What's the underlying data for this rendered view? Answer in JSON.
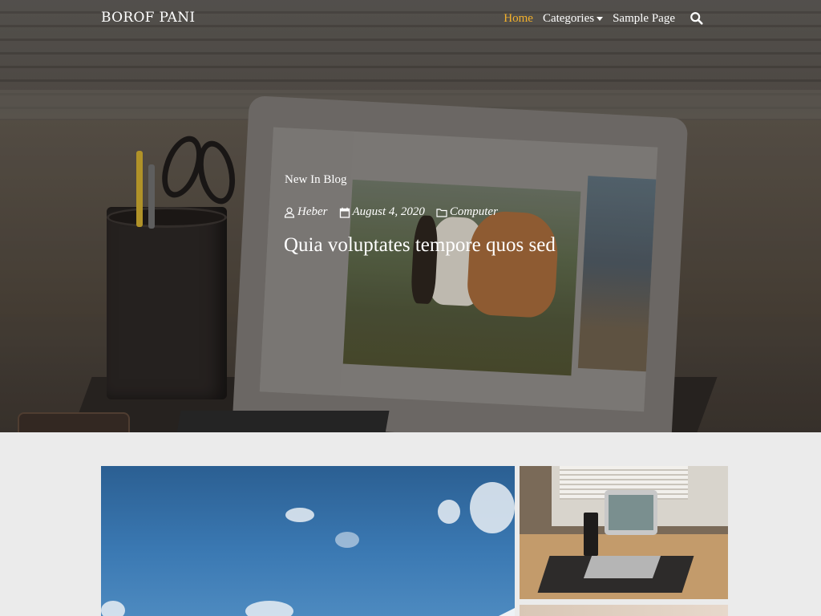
{
  "navbar": {
    "brand": "BOROF PANI",
    "links": [
      {
        "label": "Home",
        "active": true
      },
      {
        "label": "Categories",
        "dropdown": true
      },
      {
        "label": "Sample Page"
      }
    ],
    "search_icon": "search-icon"
  },
  "hero": {
    "category": "New In Blog",
    "meta": {
      "author": "Heber",
      "date": "August 4, 2020",
      "category": "Computer"
    },
    "title": "Quia voluptates tempore quos sed",
    "icons": [
      "user-icon",
      "calendar-icon",
      "folder-icon"
    ]
  },
  "colors": {
    "accent": "#f2b02c",
    "text_on_hero": "#ffffff",
    "page_background": "#ebebeb"
  }
}
